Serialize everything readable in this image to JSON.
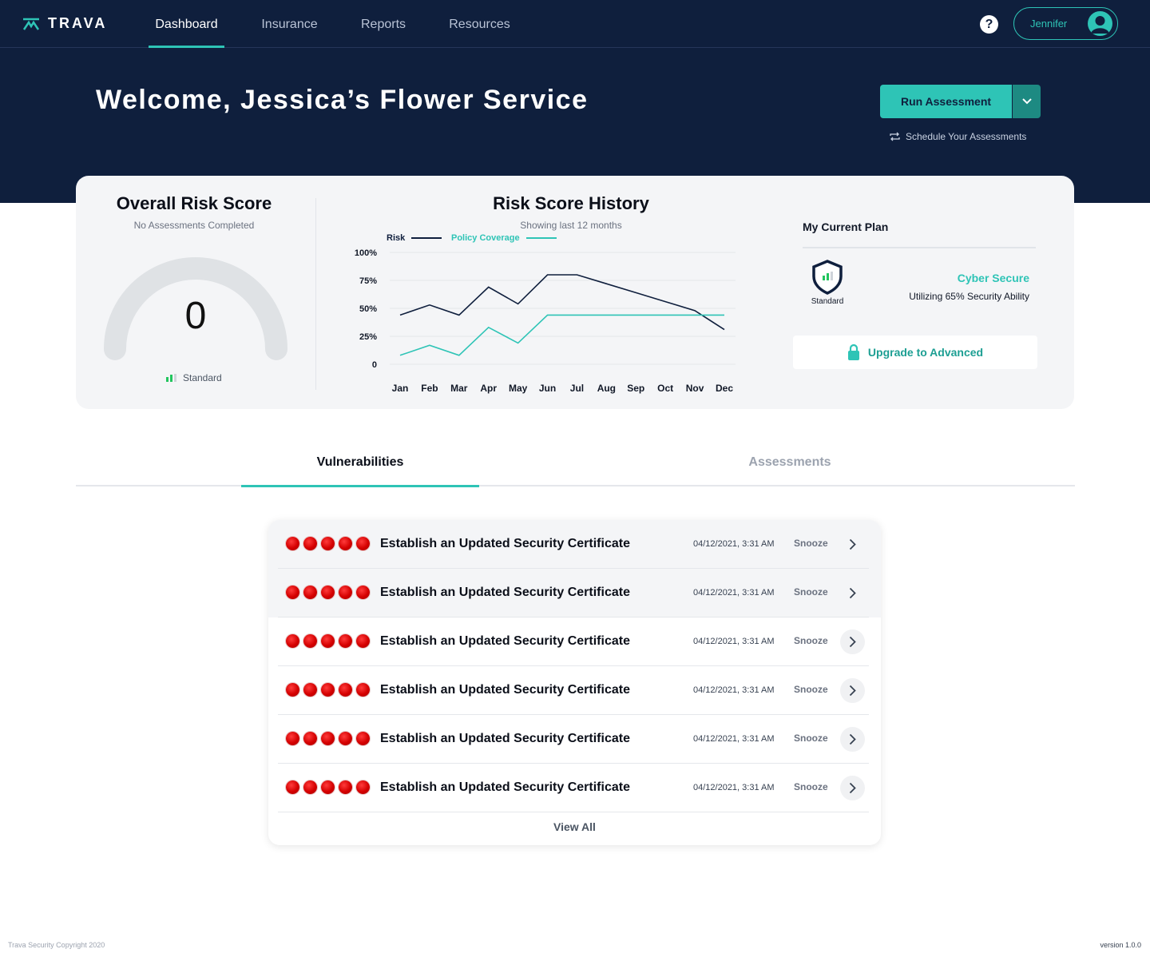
{
  "nav": {
    "brand": "TRAVA",
    "tabs": [
      {
        "label": "Dashboard",
        "active": true
      },
      {
        "label": "Insurance",
        "active": false
      },
      {
        "label": "Reports",
        "active": false
      },
      {
        "label": "Resources",
        "active": false
      }
    ],
    "help_icon": "question-circle-icon",
    "user_name": "Jennifer"
  },
  "hero": {
    "welcome": "Welcome, Jessica’s Flower Service",
    "run_button": "Run Assessment",
    "schedule_link": "Schedule Your Assessments"
  },
  "risk_score": {
    "title": "Overall Risk Score",
    "subtitle": "No Assessments Completed",
    "score": "0",
    "tier": "Standard"
  },
  "history": {
    "title": "Risk Score History",
    "subtitle": "Showing last 12 months",
    "legend": [
      {
        "name": "Risk",
        "color": "#0f1f3d"
      },
      {
        "name": "Policy Coverage",
        "color": "#2ec4b6"
      }
    ]
  },
  "chart_data": {
    "type": "line",
    "title": "Risk Score History",
    "categories": [
      "Jan",
      "Feb",
      "Mar",
      "Apr",
      "May",
      "Jun",
      "Jul",
      "Aug",
      "Sep",
      "Oct",
      "Nov",
      "Dec"
    ],
    "y_ticks": [
      "100%",
      "75%",
      "50%",
      "25%",
      "0"
    ],
    "ylim": [
      0,
      100
    ],
    "grid": true,
    "legend_position": "top-left",
    "series": [
      {
        "name": "Risk",
        "color": "#0f1f3d",
        "values": [
          44,
          53,
          44,
          69,
          54,
          80,
          80,
          72,
          64,
          56,
          48,
          31
        ]
      },
      {
        "name": "Policy Coverage",
        "color": "#2ec4b6",
        "values": [
          8,
          17,
          8,
          33,
          19,
          44,
          44,
          44,
          44,
          44,
          44,
          44
        ]
      }
    ]
  },
  "plan": {
    "title": "My Current Plan",
    "badge_label": "Standard",
    "name": "Cyber Secure",
    "utilization": "Utilizing 65% Security Ability",
    "upgrade_button": "Upgrade to Advanced"
  },
  "tabs": {
    "vulnerabilities": "Vulnerabilities",
    "assessments": "Assessments",
    "active": "vulnerabilities"
  },
  "vulnerabilities": [
    {
      "title": "Establish an Updated Security Certificate",
      "date": "04/12/2021, 3:31 AM",
      "snooze": "Snooze",
      "severity": 5
    },
    {
      "title": "Establish an Updated Security Certificate",
      "date": "04/12/2021, 3:31 AM",
      "snooze": "Snooze",
      "severity": 5
    },
    {
      "title": "Establish an Updated Security Certificate",
      "date": "04/12/2021, 3:31 AM",
      "snooze": "Snooze",
      "severity": 5
    },
    {
      "title": "Establish an Updated Security Certificate",
      "date": "04/12/2021, 3:31 AM",
      "snooze": "Snooze",
      "severity": 5
    },
    {
      "title": "Establish an Updated Security Certificate",
      "date": "04/12/2021, 3:31 AM",
      "snooze": "Snooze",
      "severity": 5
    },
    {
      "title": "Establish an Updated Security Certificate",
      "date": "04/12/2021, 3:31 AM",
      "snooze": "Snooze",
      "severity": 5
    }
  ],
  "view_all": "View All",
  "footer": {
    "copyright": "Trava Security Copyright 2020",
    "version": "version 1.0.0"
  },
  "colors": {
    "navy": "#0f1f3d",
    "teal": "#2ec4b6",
    "severity_red": "#d40000"
  }
}
